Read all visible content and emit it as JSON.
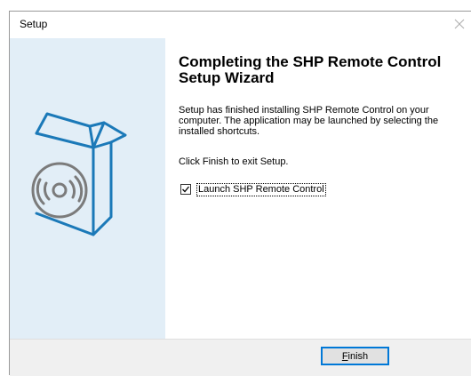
{
  "window": {
    "title": "Setup"
  },
  "wizard": {
    "heading": "Completing the SHP Remote Control Setup Wizard",
    "description": "Setup has finished installing SHP Remote Control on your computer. The application may be launched by selecting the installed shortcuts.",
    "finish_hint": "Click Finish to exit Setup.",
    "launch_option": {
      "label": "Launch SHP Remote Control",
      "checked": true
    }
  },
  "buttons": {
    "finish_accel": "F",
    "finish_rest": "inish"
  },
  "colors": {
    "sidebar_bg": "#e2eef7",
    "art_blue": "#1b79b8",
    "focus_border": "#0078d7"
  },
  "icons": {
    "close": "close-icon",
    "art": "software-box-cd-icon"
  }
}
